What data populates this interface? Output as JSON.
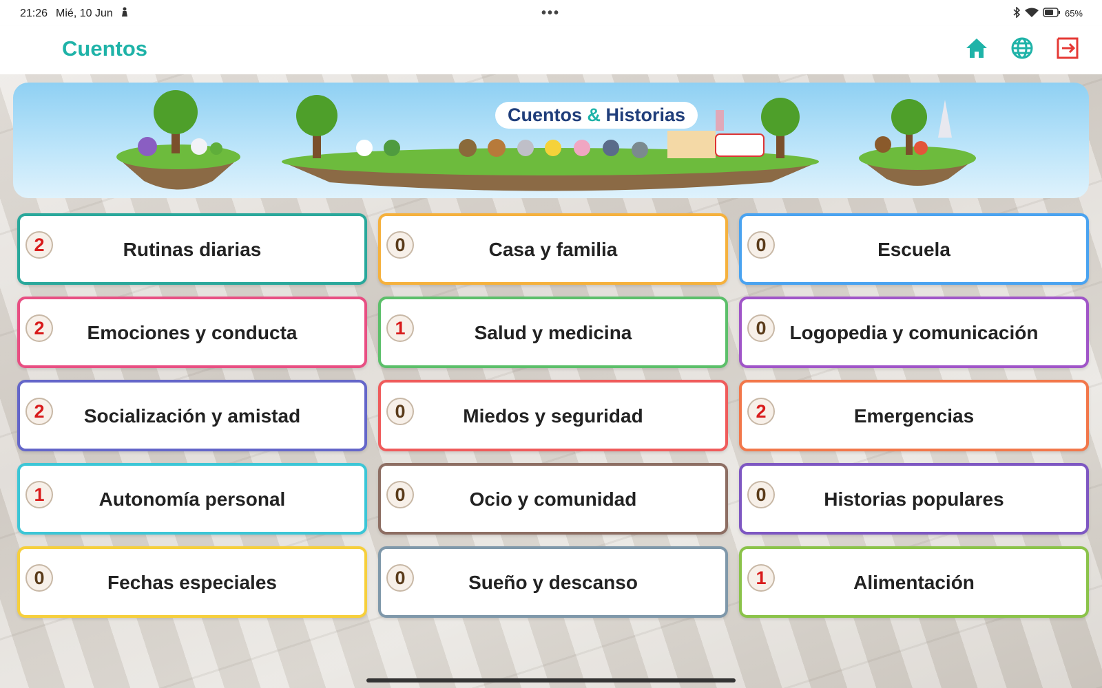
{
  "status": {
    "time": "21:26",
    "date": "Mié, 10 Jun",
    "battery": "65%"
  },
  "appbar": {
    "title": "Cuentos"
  },
  "banner": {
    "title_a": "Cuentos",
    "title_amp": "&",
    "title_b": "Historias"
  },
  "colors": {
    "accent": "#1fb3a8",
    "logout": "#e53935"
  },
  "categories": [
    {
      "label": "Rutinas diarias",
      "count": "2",
      "color": "#2aa89b"
    },
    {
      "label": "Casa y familia",
      "count": "0",
      "color": "#f5b13d"
    },
    {
      "label": "Escuela",
      "count": "0",
      "color": "#4aa3f0"
    },
    {
      "label": "Emociones y conducta",
      "count": "2",
      "color": "#e84f83"
    },
    {
      "label": "Salud y medicina",
      "count": "1",
      "color": "#5cbf6a"
    },
    {
      "label": "Logopedia y comunicación",
      "count": "0",
      "color": "#a055c8"
    },
    {
      "label": "Socialización y amistad",
      "count": "2",
      "color": "#6466c9"
    },
    {
      "label": "Miedos y seguridad",
      "count": "0",
      "color": "#ef5b5b"
    },
    {
      "label": "Emergencias",
      "count": "2",
      "color": "#f2774a"
    },
    {
      "label": "Autonomía personal",
      "count": "1",
      "color": "#3cc6d6"
    },
    {
      "label": "Ocio y comunidad",
      "count": "0",
      "color": "#8d6e63"
    },
    {
      "label": "Historias populares",
      "count": "0",
      "color": "#7e57c2"
    },
    {
      "label": "Fechas especiales",
      "count": "0",
      "color": "#f6cf3c"
    },
    {
      "label": "Sueño y descanso",
      "count": "0",
      "color": "#7f98aa"
    },
    {
      "label": "Alimentación",
      "count": "1",
      "color": "#8bc34a"
    }
  ]
}
